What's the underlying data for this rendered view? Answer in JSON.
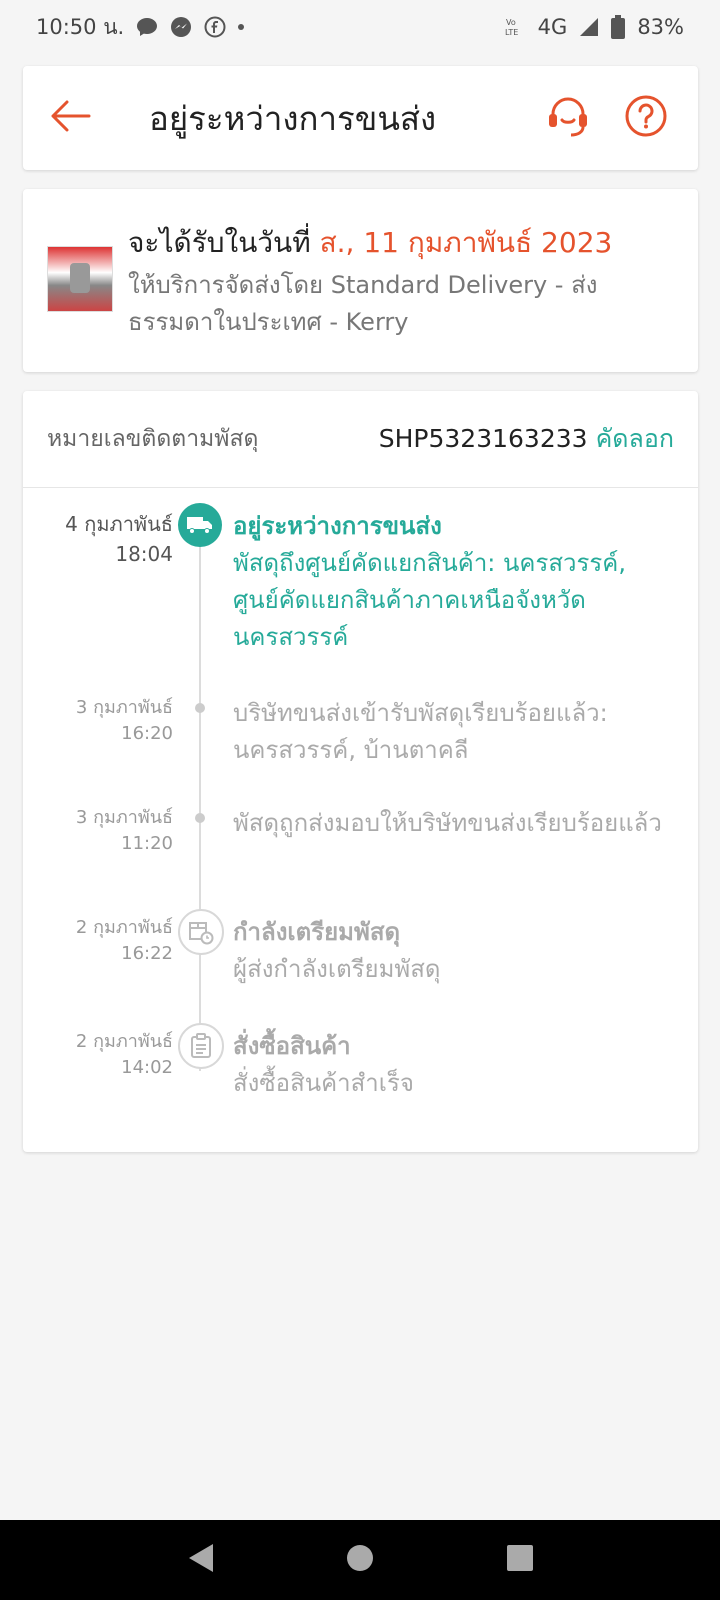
{
  "status_bar": {
    "time": "10:50 น.",
    "network": "4G",
    "battery": "83%",
    "icons": [
      "chat-bubble-icon",
      "messenger-icon",
      "facebook-icon",
      "dot-icon",
      "volte-icon",
      "signal-icon",
      "battery-icon"
    ]
  },
  "header": {
    "title": "อยู่ระหว่างการขนส่ง",
    "icons": [
      "back-arrow-icon",
      "headset-support-icon",
      "help-question-icon"
    ]
  },
  "delivery": {
    "prefix": "จะได้รับในวันที่",
    "date": "ส., 11 กุมภาพันธ์ 2023",
    "service": "ให้บริการจัดส่งโดย Standard Delivery - ส่งธรรมดาในประเทศ - Kerry"
  },
  "tracking": {
    "label": "หมายเลขติดตามพัสดุ",
    "number": "SHP5323163233",
    "copy_label": "คัดลอก"
  },
  "events": [
    {
      "date": "4 กุมภาพันธ์",
      "time": "18:04",
      "title": "อยู่ระหว่างการขนส่ง",
      "desc": "พัสดุถึงศูนย์คัดแยกสินค้า: นครสวรรค์, ศูนย์คัดแยกสินค้าภาคเหนือจังหวัดนครสวรรค์"
    },
    {
      "date": "3 กุมภาพันธ์",
      "time": "16:20",
      "desc": "บริษัทขนส่งเข้ารับพัสดุเรียบร้อยแล้ว: นครสวรรค์, บ้านตาคลี"
    },
    {
      "date": "3 กุมภาพันธ์",
      "time": "11:20",
      "desc": "พัสดุถูกส่งมอบให้บริษัทขนส่งเรียบร้อยแล้ว"
    },
    {
      "date": "2 กุมภาพันธ์",
      "time": "16:22",
      "title": "กำลังเตรียมพัสดุ",
      "desc": "ผู้ส่งกำลังเตรียมพัสดุ"
    },
    {
      "date": "2 กุมภาพันธ์",
      "time": "14:02",
      "title": "สั่งซื้อสินค้า",
      "desc": "สั่งซื้อสินค้าสำเร็จ"
    }
  ],
  "colors": {
    "accent_orange": "#e5532d",
    "accent_teal": "#26aa99",
    "muted_text": "#aaaaaa"
  }
}
